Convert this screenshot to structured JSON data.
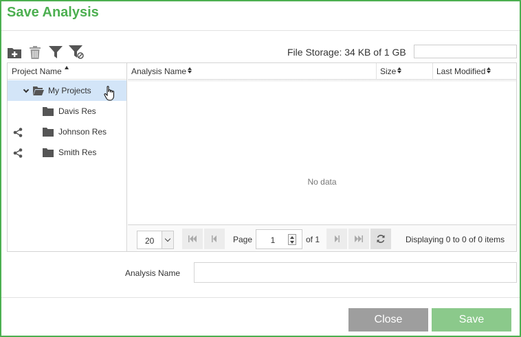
{
  "dialog": {
    "title": "Save Analysis"
  },
  "toolbar": {
    "icons": [
      "new-folder-icon",
      "trash-icon",
      "filter-icon",
      "clear-filter-icon"
    ],
    "storage_text": "File Storage: 34 KB of 1 GB",
    "search_value": ""
  },
  "tree": {
    "header": "Project Name",
    "items": [
      {
        "label": "My Projects",
        "level": 0,
        "expanded": true,
        "selected": true,
        "shared": false
      },
      {
        "label": "Davis Res",
        "level": 1,
        "selected": false,
        "shared": false
      },
      {
        "label": "Johnson Res",
        "level": 1,
        "selected": false,
        "shared": true
      },
      {
        "label": "Smith Res",
        "level": 1,
        "selected": false,
        "shared": true
      }
    ]
  },
  "grid": {
    "columns": [
      "Analysis Name",
      "Size",
      "Last Modified"
    ],
    "empty_text": "No data"
  },
  "pager": {
    "page_size": "20",
    "page_label": "Page",
    "page_value": "1",
    "of_text": "of 1",
    "display_text": "Displaying 0 to 0 of 0 items"
  },
  "form": {
    "analysis_name_label": "Analysis Name",
    "analysis_name_value": ""
  },
  "buttons": {
    "close": "Close",
    "save": "Save"
  },
  "colors": {
    "accent": "#4caf50",
    "selected_row": "#d3e5f8",
    "close_btn": "#9e9e9e",
    "save_btn": "#8bc98b"
  }
}
